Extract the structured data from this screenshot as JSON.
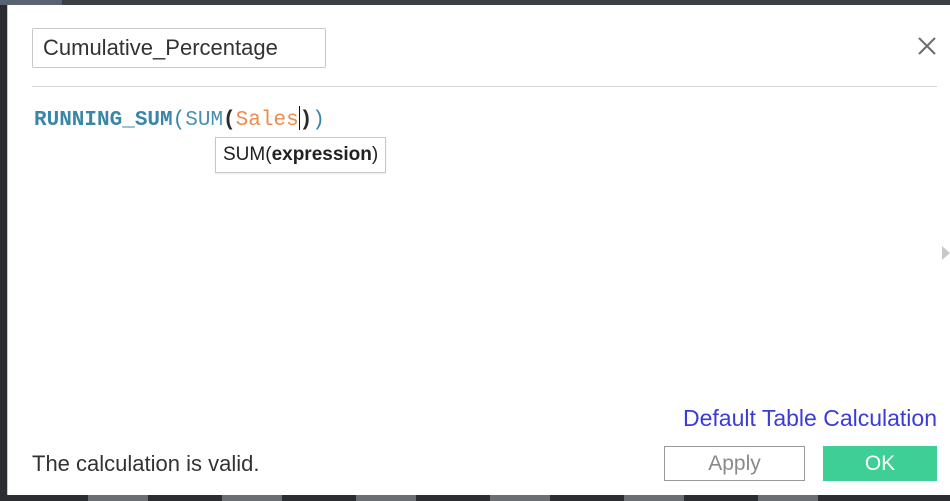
{
  "calc_name": "Cumulative_Percentage",
  "formula": {
    "func_outer": "RUNNING_SUM",
    "open_outer": "(",
    "func_inner": "SUM",
    "open_inner": "(",
    "field": "Sales",
    "close_inner": ")",
    "close_outer": ")"
  },
  "tooltip": {
    "func": "SUM",
    "open": "(",
    "arg": "expression",
    "close": ")"
  },
  "default_table_calc_link": "Default Table Calculation",
  "status_text": "The calculation is valid.",
  "buttons": {
    "apply": "Apply",
    "ok": "OK"
  },
  "icons": {
    "close": "close-icon",
    "scroll": "scroll-right-arrow-icon"
  },
  "colors": {
    "function": "#3a86a8",
    "field": "#f08a4b",
    "ok_button": "#3ecf96",
    "link": "#3b3bdc"
  }
}
